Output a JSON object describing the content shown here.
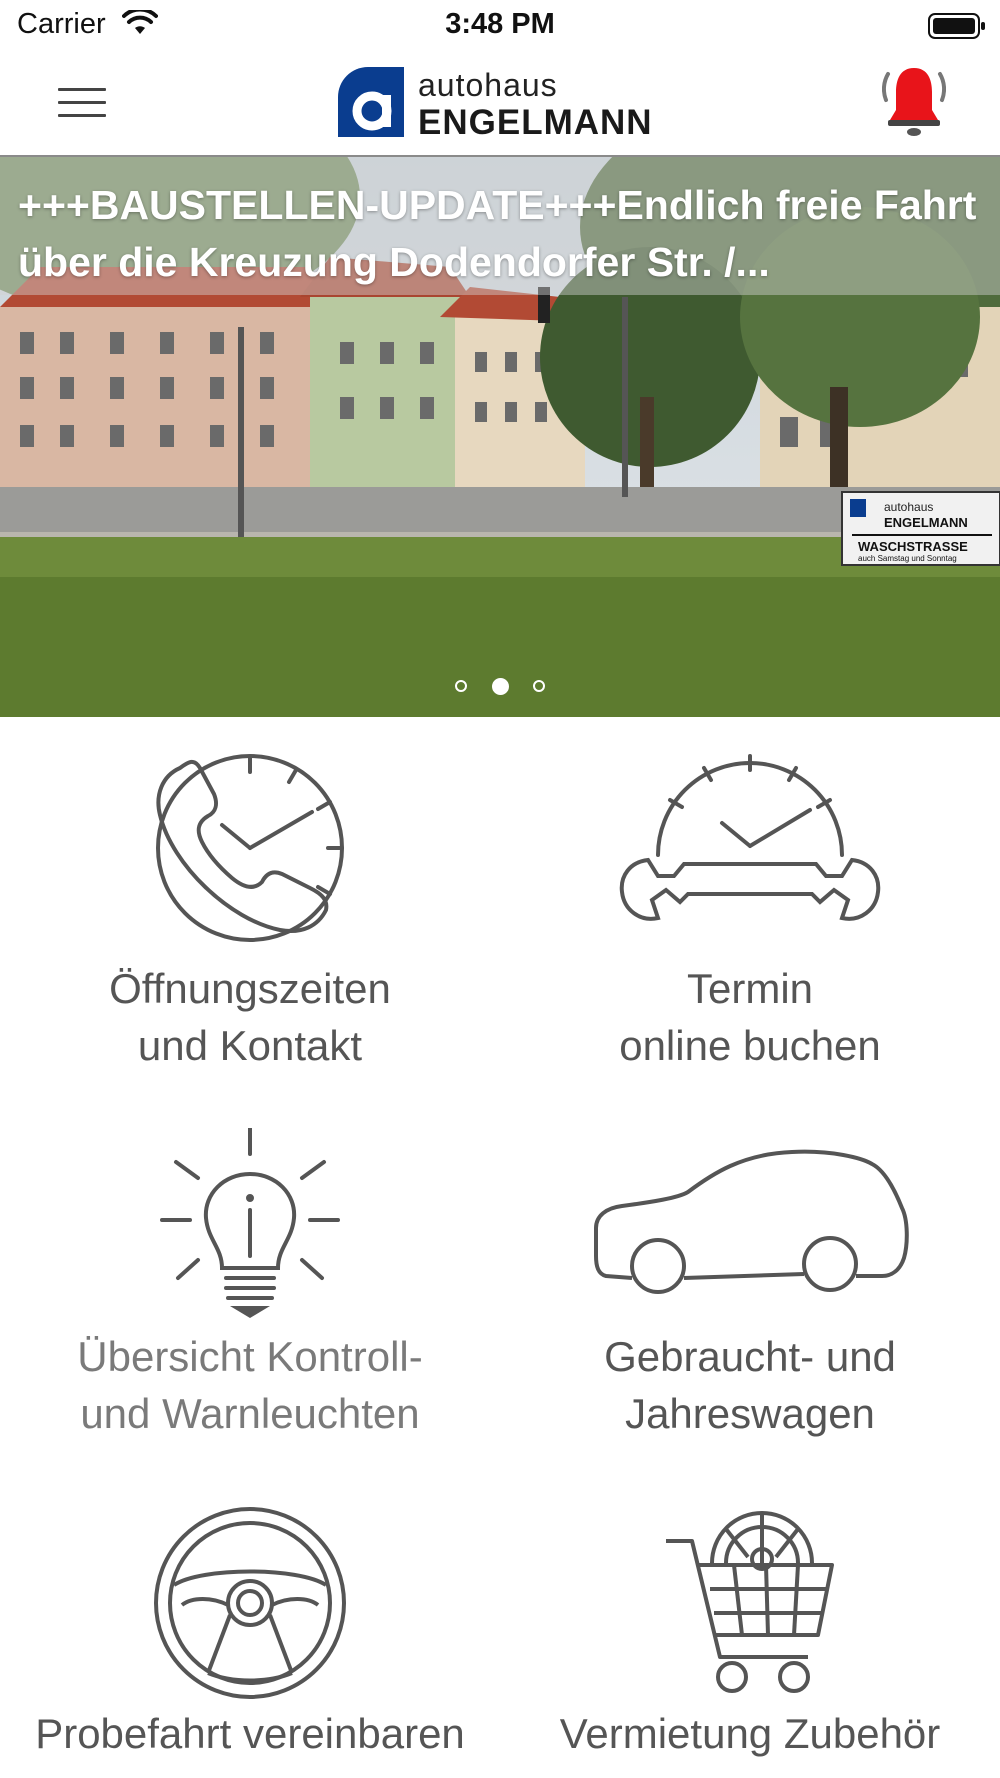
{
  "status_bar": {
    "carrier": "Carrier",
    "time": "3:48 PM"
  },
  "header": {
    "logo_top": "autohaus",
    "logo_bottom": "ENGELMANN",
    "menu_icon": "hamburger-menu-icon",
    "bell_icon": "alarm-bell-icon",
    "bell_color": "#e8141a"
  },
  "hero": {
    "headline": "+++BAUSTELLEN-UPDATE+++Endlich freie Fahrt über die Kreuzung Dodendorfer Str. /...",
    "sign": {
      "line1": "autohaus",
      "line2": "ENGELMANN",
      "line3": "WASCHSTRASSE",
      "line4": "auch Samstag und Sonntag"
    },
    "pagination": {
      "count": 3,
      "active_index": 1
    }
  },
  "tiles": [
    {
      "line1": "Öffnungszeiten",
      "line2": "und Kontakt",
      "icon": "phone-clock-icon"
    },
    {
      "line1": "Termin",
      "line2": "online buchen",
      "icon": "clock-wrench-icon"
    },
    {
      "line1": "Übersicht Kontroll-",
      "line2": "und Warnleuchten",
      "icon": "lightbulb-icon"
    },
    {
      "line1": "Gebraucht- und",
      "line2": "Jahreswagen",
      "icon": "car-icon"
    },
    {
      "line1": "Probefahrt vereinbaren",
      "icon": "steering-wheel-icon"
    },
    {
      "line1": "Vermietung Zubehör",
      "icon": "shopping-cart-wheel-icon"
    }
  ],
  "colors": {
    "accent_blue": "#0a3d8f",
    "icon_gray": "#555555"
  }
}
